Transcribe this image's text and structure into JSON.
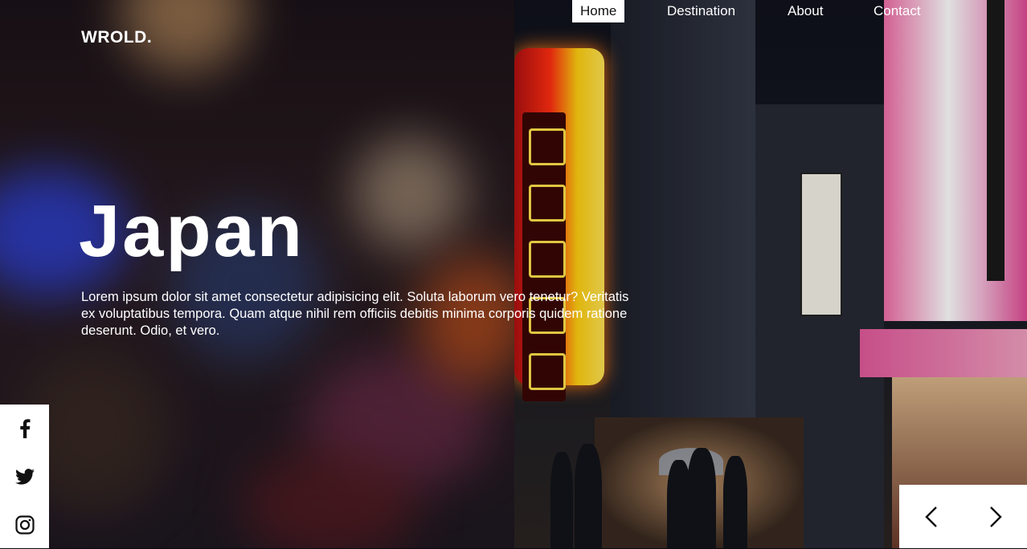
{
  "brand": {
    "logo": "WROLD."
  },
  "nav": {
    "items": [
      {
        "label": "Home",
        "active": true
      },
      {
        "label": "Destination",
        "active": false
      },
      {
        "label": "About",
        "active": false
      },
      {
        "label": "Contact",
        "active": false
      }
    ]
  },
  "hero": {
    "title": "Japan",
    "description": "Lorem ipsum dolor sit amet consectetur adipisicing elit. Soluta laborum vero tenetur? Veritatis ex voluptatibus tempora. Quam atque nihil rem officiis debitis minima corporis quidem ratione deserunt. Odio, et vero."
  },
  "social": {
    "icons": [
      "facebook-icon",
      "twitter-icon",
      "instagram-icon"
    ]
  },
  "slider": {
    "icons": [
      "chevron-left-icon",
      "chevron-right-icon"
    ]
  },
  "colors": {
    "text": "#ffffff",
    "active_nav_bg": "#ffffff",
    "active_nav_text": "#111111",
    "panel_bg": "#ffffff",
    "icon": "#111111"
  }
}
